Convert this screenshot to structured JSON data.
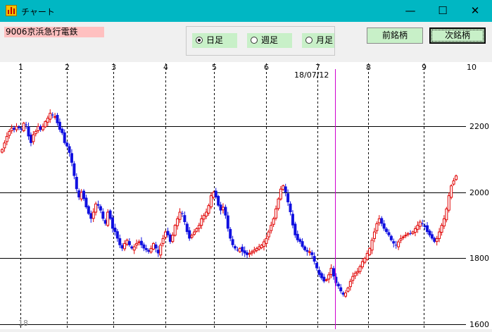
{
  "window": {
    "title": "チャート",
    "minimize_glyph": "—",
    "maximize_glyph": "☐",
    "close_glyph": "✕",
    "app_icon": "chart-app-icon"
  },
  "toolbar": {
    "stock_label": "9006京浜急行電鉄",
    "stock_label_color": "#ffc0c0",
    "radios": [
      {
        "label": "日足",
        "selected": true
      },
      {
        "label": "週足",
        "selected": false
      },
      {
        "label": "月足",
        "selected": false
      }
    ],
    "prev_button": "前銘柄",
    "next_button": "次銘柄",
    "button_color": "#c8f0c8"
  },
  "chart_data": {
    "type": "candlestick",
    "title": "",
    "xlabel": "",
    "ylabel": "",
    "ylim": [
      1600,
      2400
    ],
    "y_gridlines": [
      1600,
      1800,
      2000,
      2200
    ],
    "y_tick_labels": [
      "2200",
      "2000",
      "1800",
      "1600"
    ],
    "month_labels": [
      "1",
      "2",
      "3",
      "4",
      "5",
      "6",
      "7",
      "8",
      "9",
      "10"
    ],
    "cursor_date_label": "18/07/12",
    "year_label": "18",
    "up_color": "#e00000",
    "down_color": "#1010e0",
    "cursor_color": "#d000d0",
    "grid": true,
    "closes": [
      2130,
      2150,
      2170,
      2185,
      2195,
      2190,
      2200,
      2195,
      2190,
      2210,
      2205,
      2170,
      2150,
      2175,
      2185,
      2200,
      2190,
      2200,
      2215,
      2225,
      2240,
      2235,
      2230,
      2210,
      2190,
      2180,
      2150,
      2140,
      2120,
      2090,
      2050,
      2010,
      1985,
      2000,
      1980,
      1955,
      1935,
      1920,
      1940,
      1965,
      1960,
      1945,
      1920,
      1905,
      1940,
      1920,
      1890,
      1880,
      1860,
      1840,
      1830,
      1845,
      1855,
      1840,
      1830,
      1835,
      1845,
      1850,
      1840,
      1830,
      1825,
      1820,
      1830,
      1845,
      1830,
      1815,
      1840,
      1860,
      1880,
      1870,
      1850,
      1870,
      1900,
      1920,
      1940,
      1935,
      1910,
      1880,
      1860,
      1870,
      1880,
      1890,
      1900,
      1920,
      1930,
      1940,
      1960,
      1990,
      2000,
      1985,
      1960,
      1945,
      1955,
      1930,
      1890,
      1860,
      1840,
      1830,
      1825,
      1830,
      1820,
      1815,
      1810,
      1815,
      1820,
      1825,
      1830,
      1835,
      1840,
      1850,
      1860,
      1880,
      1900,
      1920,
      1950,
      1980,
      2010,
      2020,
      2000,
      1970,
      1940,
      1900,
      1870,
      1855,
      1850,
      1835,
      1825,
      1820,
      1820,
      1810,
      1790,
      1770,
      1750,
      1740,
      1730,
      1735,
      1750,
      1770,
      1745,
      1725,
      1715,
      1700,
      1690,
      1695,
      1710,
      1730,
      1745,
      1755,
      1760,
      1775,
      1790,
      1800,
      1815,
      1830,
      1855,
      1880,
      1905,
      1920,
      1905,
      1890,
      1880,
      1870,
      1855,
      1845,
      1840,
      1850,
      1860,
      1865,
      1870,
      1875,
      1875,
      1880,
      1890,
      1900,
      1910,
      1905,
      1895,
      1880,
      1870,
      1860,
      1850,
      1860,
      1880,
      1900,
      1920,
      1950,
      1990,
      2020,
      2035,
      2050
    ]
  }
}
